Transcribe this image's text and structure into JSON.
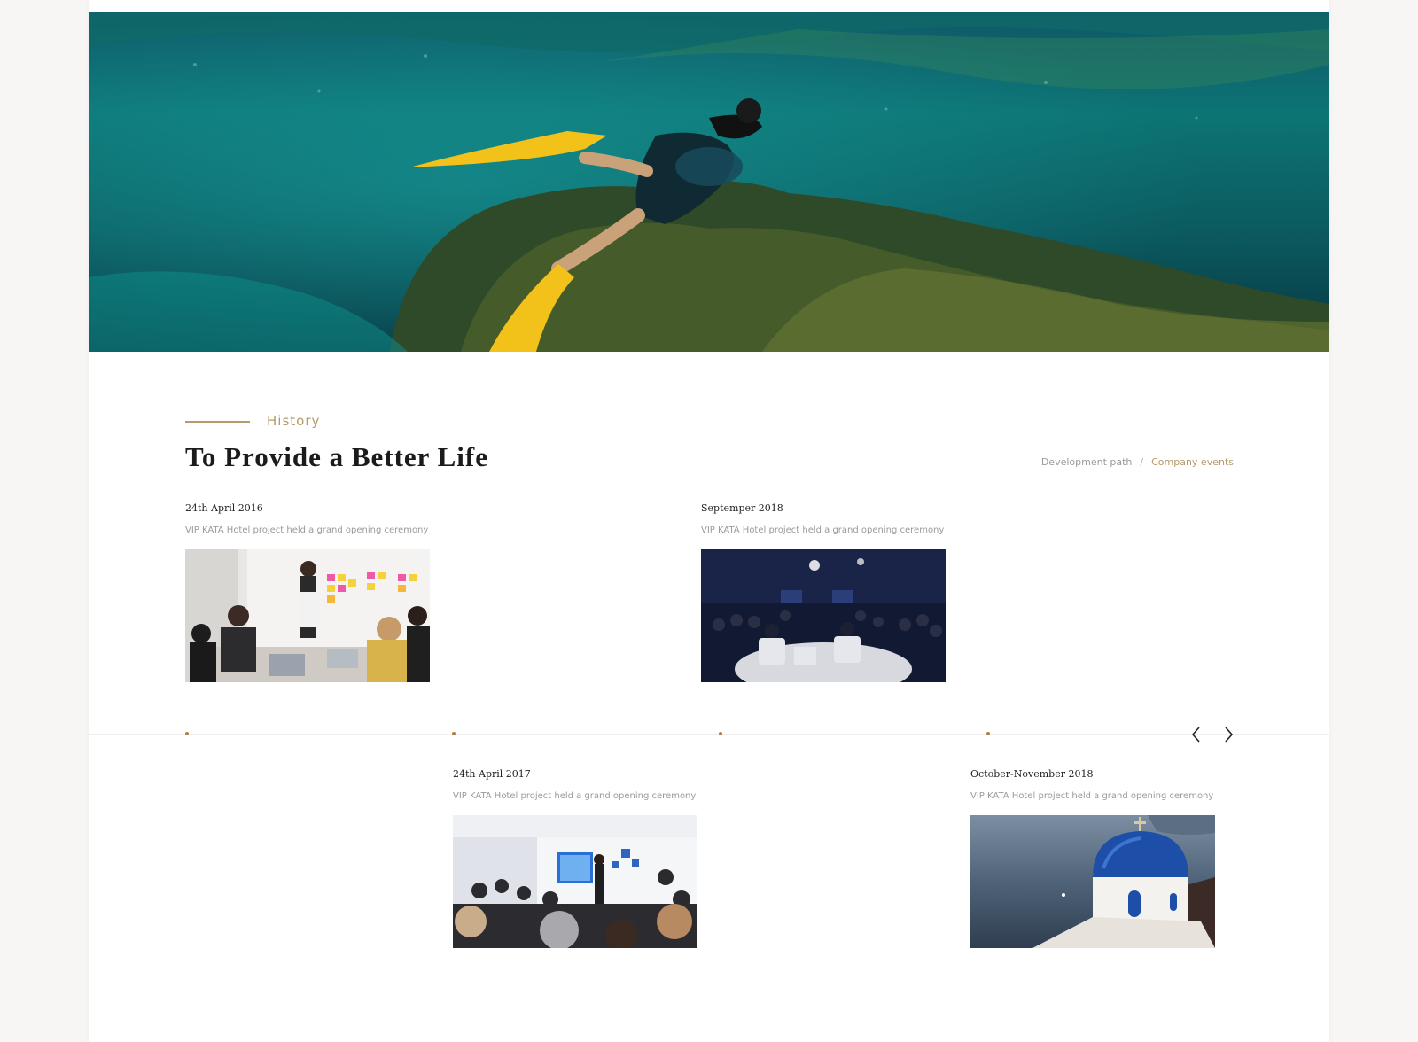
{
  "hero": {
    "image": "snorkeler-underwater-reef"
  },
  "section": {
    "eyebrow": "History",
    "title": "To Provide a Better Life"
  },
  "filters": {
    "items": [
      "Development path",
      "Company events"
    ],
    "separator": "/",
    "active_index": 1
  },
  "events": [
    {
      "date": "24th April 2016",
      "desc": "VIP KATA Hotel project held a grand opening ceremony",
      "image": "team-meeting-sticky-notes"
    },
    {
      "date": "Septemper 2018",
      "desc": "VIP KATA Hotel project held a grand opening ceremony",
      "image": "panel-discussion-stage"
    },
    {
      "date": "24th April 2017",
      "desc": "VIP KATA Hotel project held a grand opening ceremony",
      "image": "conference-presentation"
    },
    {
      "date": "October-November 2018",
      "desc": "VIP KATA Hotel project held a grand opening ceremony",
      "image": "santorini-blue-dome"
    }
  ],
  "nav": {
    "prev_icon": "chevron-left-icon",
    "next_icon": "chevron-right-icon"
  },
  "colors": {
    "accent": "#b59a6a",
    "dot": "#b07e4a",
    "text": "#1b1b1b",
    "muted": "#9a9a9a"
  }
}
